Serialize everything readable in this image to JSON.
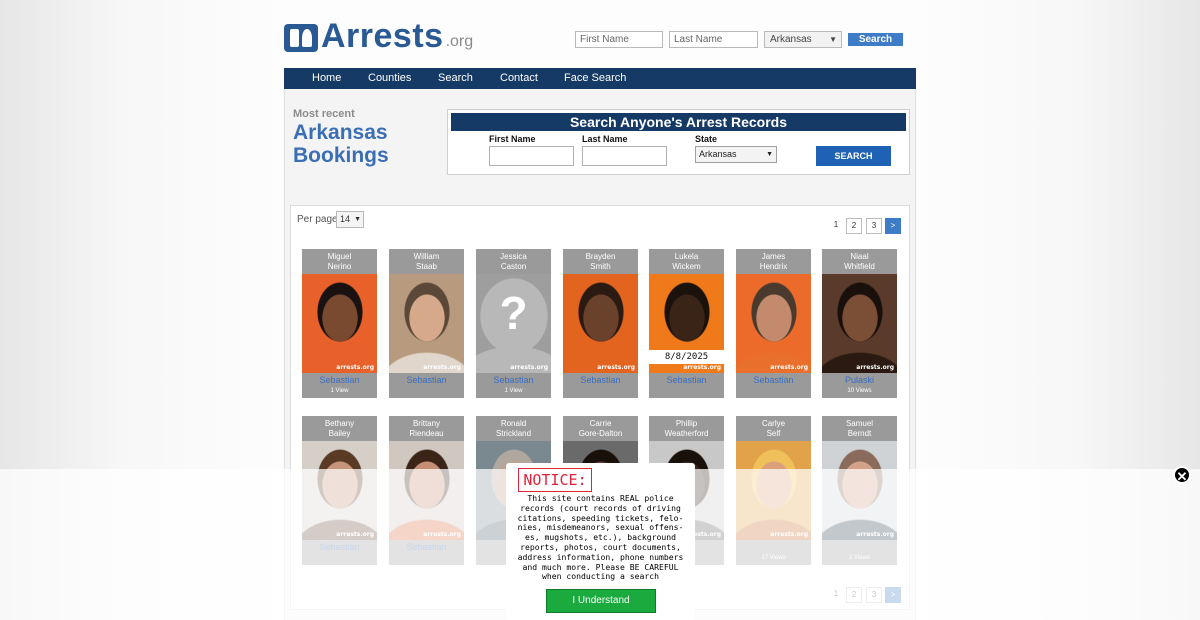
{
  "header": {
    "logo_text": "Arrests",
    "logo_ext": ".org",
    "first_name_placeholder": "First Name",
    "last_name_placeholder": "Last Name",
    "state_value": "Arkansas",
    "search_label": "Search"
  },
  "nav": [
    "Home",
    "Counties",
    "Search",
    "Contact",
    "Face Search"
  ],
  "intro": {
    "label": "Most recent",
    "title_line1": "Arkansas",
    "title_line2": "Bookings"
  },
  "search_box": {
    "heading": "Search Anyone's Arrest Records",
    "first_name_label": "First Name",
    "last_name_label": "Last Name",
    "state_label": "State",
    "state_value": "Arkansas",
    "button_label": "SEARCH"
  },
  "listing": {
    "per_page_label": "Per page",
    "per_page_value": "14",
    "pages": [
      "1",
      "2",
      "3",
      ">"
    ]
  },
  "bookings": [
    {
      "first": "Miguel",
      "last": "Nerino",
      "county": "Sebastian",
      "views": "1 View",
      "photo": "mugshot-man-beard"
    },
    {
      "first": "William",
      "last": "Staab",
      "county": "Sebastian",
      "views": "",
      "photo": "mugshot-man-profile"
    },
    {
      "first": "Jessica",
      "last": "Caston",
      "county": "Sebastian",
      "views": "1 View",
      "photo": "placeholder-question"
    },
    {
      "first": "Brayden",
      "last": "Smith",
      "county": "Sebastian",
      "views": "",
      "photo": "mugshot-man-young"
    },
    {
      "first": "Lukela",
      "last": "Wickem",
      "county": "Sebastian",
      "views": "",
      "photo": "mugshot-woman-orange"
    },
    {
      "first": "James",
      "last": "Hendrix",
      "county": "Sebastian",
      "views": "",
      "photo": "mugshot-man-older"
    },
    {
      "first": "Niaal",
      "last": "Whitfield",
      "county": "Pulaski",
      "views": "10 Views",
      "photo": "mugshot-woman-dark"
    },
    {
      "first": "Bethany",
      "last": "Bailey",
      "county": "Sebastian",
      "views": "",
      "photo": "mugshot-woman-brown"
    },
    {
      "first": "Brittany",
      "last": "Riendeau",
      "county": "Sebastian",
      "views": "",
      "photo": "mugshot-woman-brown2"
    },
    {
      "first": "Ronald",
      "last": "Strickland",
      "county": "",
      "views": "",
      "photo": "mugshot-man-gray"
    },
    {
      "first": "Carrie",
      "last": "Gore-Dalton",
      "county": "",
      "views": "",
      "photo": "mugshot-woman-dark2"
    },
    {
      "first": "Phillip",
      "last": "Weatherford",
      "county": "",
      "views": "",
      "photo": "mugshot-man-dark"
    },
    {
      "first": "Carlye",
      "last": "Self",
      "county": "",
      "views": "17 Views",
      "photo": "mugshot-woman-blonde"
    },
    {
      "first": "Samuel",
      "last": "Berndt",
      "county": "",
      "views": "2 Views",
      "photo": "mugshot-man-bald"
    }
  ],
  "watermark": "arrests.org",
  "lukela_date": "8/8/2025",
  "notice": {
    "title": "NOTICE:",
    "body_lines": [
      "This site contains REAL police",
      "records (court records of driving",
      "citations, speeding tickets, felo-",
      "nies, misdemeanors, sexual offens-",
      "es, mugshots, etc.), background",
      "reports, photos, court documents,",
      "address information, phone numbers",
      "and much more. Please BE CAREFUL",
      "when conducting a search"
    ],
    "button_label": "I Understand",
    "close_icon": "close-icon"
  },
  "colors": {
    "brand_blue": "#2a5a93",
    "nav_navy": "#163a66",
    "link_blue": "#3b6fc1",
    "notice_red": "#e2223a",
    "accept_green": "#1aaa3e"
  }
}
